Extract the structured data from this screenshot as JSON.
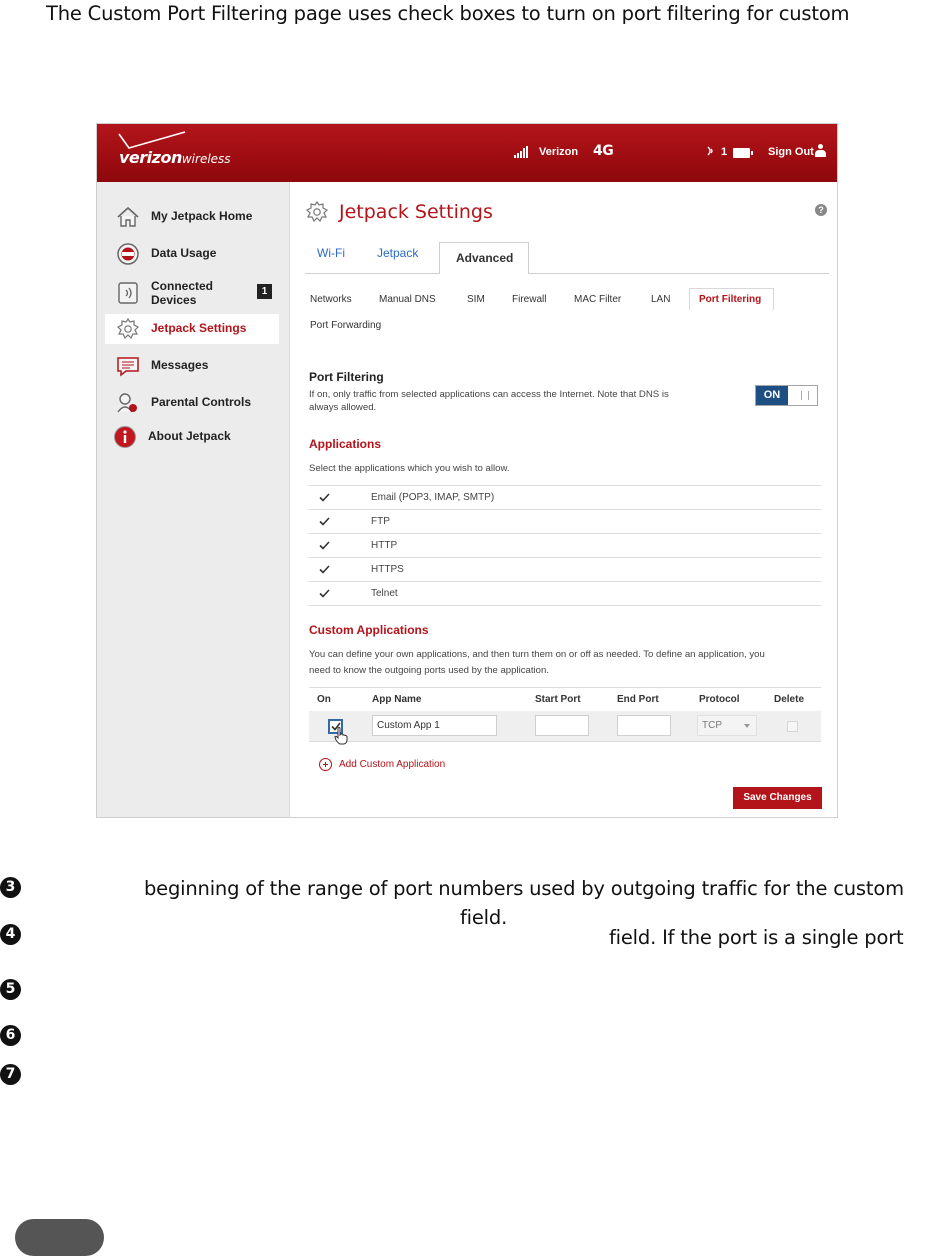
{
  "document": {
    "intro_line": "The Custom Port Filtering page uses check boxes to turn on port filtering for custom",
    "steps": [
      {
        "bullet": "3",
        "lines": [
          "beginning of the range of port numbers used by outgoing traffic for the custom",
          "field."
        ]
      },
      {
        "bullet": "4",
        "lines": [
          "field. If the port is a single port"
        ]
      },
      {
        "bullet": "5",
        "lines": []
      },
      {
        "bullet": "6",
        "lines": []
      },
      {
        "bullet": "7",
        "lines": []
      }
    ]
  },
  "header": {
    "brand": "verizon",
    "brand_suffix": "wireless",
    "carrier": "Verizon",
    "network": "4G",
    "connected_count": "1",
    "sign_out": "Sign Out",
    "colors": {
      "brand_red": "#b3141a",
      "link_blue": "#2a6ac5",
      "toggle_on": "#1d4f82"
    }
  },
  "sidebar": {
    "items": [
      {
        "label": "My Jetpack Home",
        "icon": "home-icon"
      },
      {
        "label": "Data Usage",
        "icon": "data-usage-icon"
      },
      {
        "label": "Connected Devices",
        "icon": "connected-devices-icon",
        "badge": "1"
      },
      {
        "label": "Jetpack Settings",
        "icon": "gear-icon",
        "active": true
      },
      {
        "label": "Messages",
        "icon": "messages-icon"
      },
      {
        "label": "Parental Controls",
        "icon": "parental-controls-icon"
      },
      {
        "label": "About Jetpack",
        "icon": "info-icon"
      }
    ]
  },
  "main": {
    "title": "Jetpack Settings",
    "help": "?",
    "tabs": [
      {
        "label": "Wi-Fi"
      },
      {
        "label": "Jetpack"
      },
      {
        "label": "Advanced",
        "active": true
      }
    ],
    "subtabs": [
      {
        "label": "Networks"
      },
      {
        "label": "Manual DNS"
      },
      {
        "label": "SIM"
      },
      {
        "label": "Firewall"
      },
      {
        "label": "MAC Filter"
      },
      {
        "label": "LAN"
      },
      {
        "label": "Port Filtering",
        "active": true
      },
      {
        "label": "Port Forwarding"
      }
    ],
    "port_filtering": {
      "heading": "Port Filtering",
      "description_line1": "If on, only traffic from selected applications can access the Internet. Note that DNS is",
      "description_line2": "always allowed.",
      "toggle_label": "ON",
      "toggle_state": "on"
    },
    "applications": {
      "heading": "Applications",
      "instruction": "Select the applications which you wish to allow.",
      "items": [
        {
          "label": "Email (POP3, IMAP, SMTP)",
          "checked": true
        },
        {
          "label": "FTP",
          "checked": true
        },
        {
          "label": "HTTP",
          "checked": true
        },
        {
          "label": "HTTPS",
          "checked": true
        },
        {
          "label": "Telnet",
          "checked": true
        }
      ]
    },
    "custom_applications": {
      "heading": "Custom Applications",
      "description_line1": "You can define your own applications, and then turn them on or off as needed. To define an application, you",
      "description_line2": "need to know the outgoing ports used by the application.",
      "columns": [
        "On",
        "App Name",
        "Start Port",
        "End Port",
        "Protocol",
        "Delete"
      ],
      "rows": [
        {
          "on": true,
          "app_name": "Custom App 1",
          "start_port": "",
          "end_port": "",
          "protocol": "TCP",
          "delete": false
        }
      ],
      "add_label": "Add Custom Application"
    },
    "save_label": "Save Changes"
  }
}
